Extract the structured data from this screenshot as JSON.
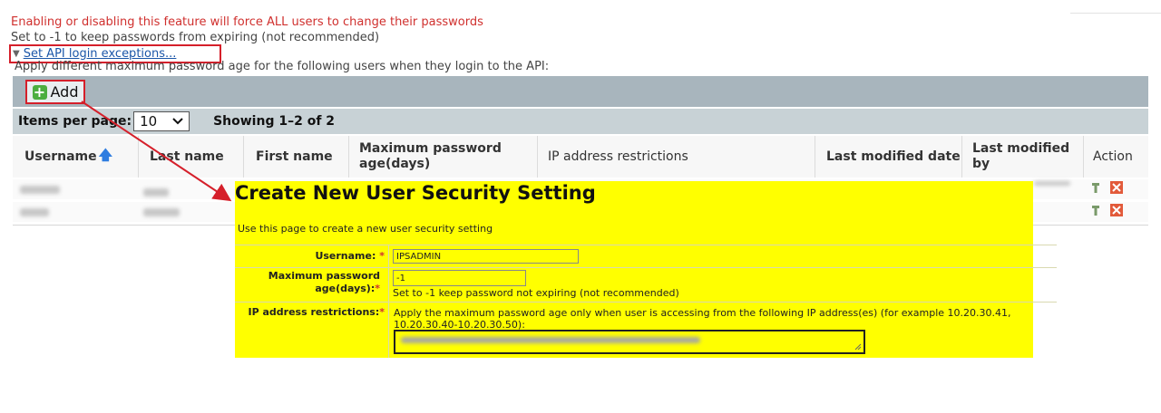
{
  "intro": {
    "warning": "Enabling or disabling this feature will force ALL users to change their passwords",
    "note": "Set to -1 to keep passwords from expiring (not recommended)",
    "api_exceptions_link": "Set API login exceptions...",
    "apply_text": "Apply different maximum password age for the following users when they login to the API:"
  },
  "toolbar": {
    "add_label": "Add"
  },
  "pager": {
    "items_label": "Items per page:",
    "page_size": "10",
    "showing": "Showing 1–2 of 2"
  },
  "table": {
    "columns": [
      "Username",
      "Last name",
      "First name",
      "Maximum password age(days)",
      "IP address restrictions",
      "Last modified date",
      "Last modified by",
      "Action"
    ]
  },
  "dialog": {
    "title": "Create New User Security Setting",
    "subtitle": "Use this page to create a new user security setting",
    "username_label": "Username:",
    "username_value": "IPSADMIN",
    "maxage_label_1": "Maximum password",
    "maxage_label_2": "age(days):",
    "maxage_value": "-1",
    "maxage_hint": "Set to -1 keep password not expiring (not recommended)",
    "ip_label": "IP address restrictions:",
    "ip_hint_1": "Apply the maximum password age only when user is accessing from the following IP address(es) (for example 10.20.30.41,",
    "ip_hint_2": "10.20.30.40-10.20.30.50):",
    "required_mark": "*"
  },
  "colors": {
    "highlight": "#ffff00",
    "annotation_red": "#d51f2a",
    "warning_red": "#d0302e",
    "link_blue": "#1b56a8",
    "toolbar_gray": "#a8b5bd"
  },
  "icons": [
    "triangle-down-icon",
    "plus-icon",
    "chevron-down-icon",
    "sort-up-arrow-icon",
    "edit-icon",
    "delete-icon"
  ]
}
